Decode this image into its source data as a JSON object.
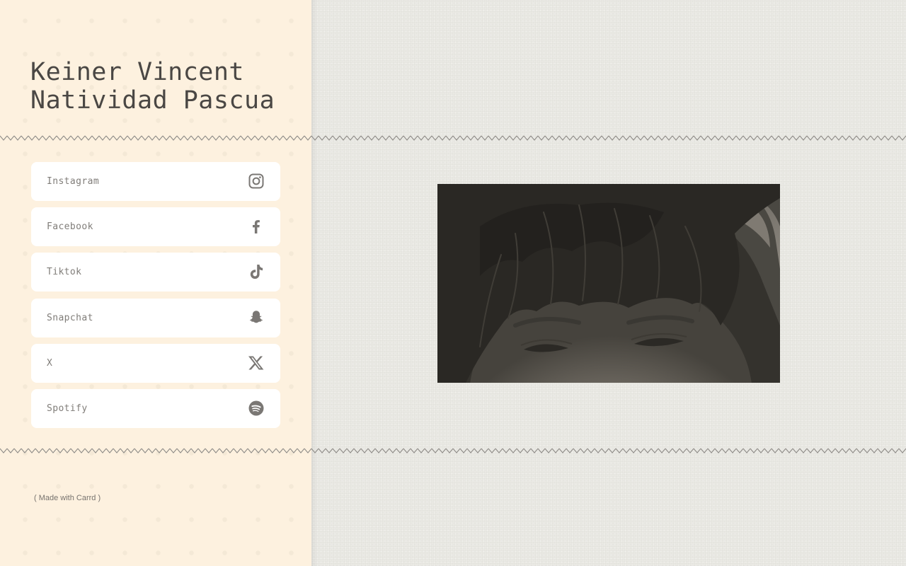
{
  "profile": {
    "name_line1": "Keiner Vincent",
    "name_line2": "Natividad Pascua"
  },
  "links": [
    {
      "label": "Instagram",
      "icon": "instagram-icon"
    },
    {
      "label": "Facebook",
      "icon": "facebook-icon"
    },
    {
      "label": "Tiktok",
      "icon": "tiktok-icon"
    },
    {
      "label": "Snapchat",
      "icon": "snapchat-icon"
    },
    {
      "label": "X",
      "icon": "x-icon"
    },
    {
      "label": "Spotify",
      "icon": "spotify-icon"
    }
  ],
  "footer": {
    "text": "( Made with Carrd )"
  },
  "colors": {
    "left_background": "#fdf1df",
    "right_background": "#eae9e4",
    "title_text": "#4a4744",
    "link_text": "#807d79",
    "icon": "#7a7774",
    "zigzag": "#8f8c88"
  }
}
